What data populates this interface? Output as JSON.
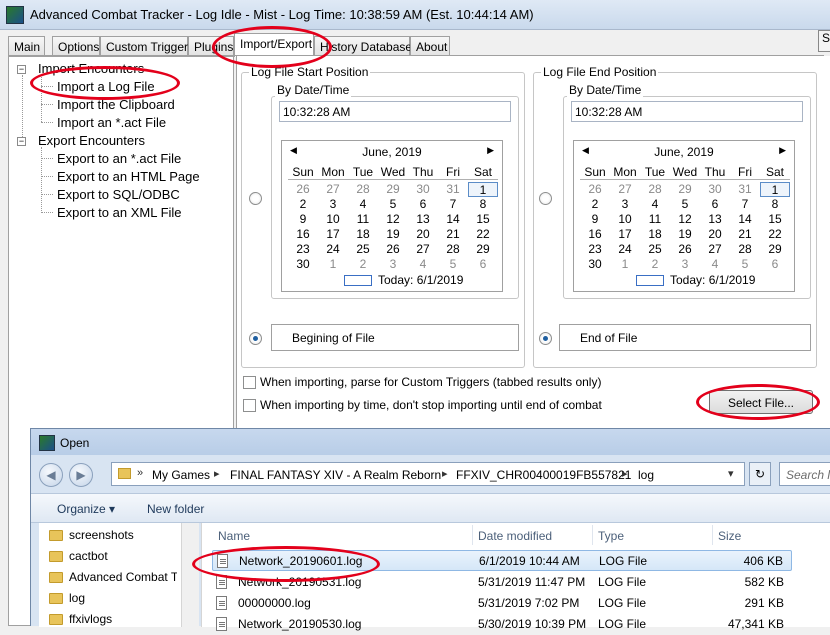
{
  "window": {
    "title": "Advanced Combat Tracker - Log Idle - Mist - Log Time: 10:38:59 AM (Est. 10:44:14 AM)"
  },
  "tabs": [
    {
      "label": "Main"
    },
    {
      "label": "Options"
    },
    {
      "label": "Custom Triggers"
    },
    {
      "label": "Plugins"
    },
    {
      "label": "Import/Export"
    },
    {
      "label": "History Database"
    },
    {
      "label": "About"
    }
  ],
  "tree": {
    "import_group": "Import Encounters",
    "import_items": [
      "Import a Log File",
      "Import the Clipboard",
      "Import an *.act File"
    ],
    "export_group": "Export Encounters",
    "export_items": [
      "Export to an *.act File",
      "Export to an HTML Page",
      "Export to SQL/ODBC",
      "Export to an XML File"
    ]
  },
  "start": {
    "legend": "Log File Start Position",
    "by_date_legend": "By Date/Time",
    "time": "10:32:28 AM",
    "edge_label": "Begining of File"
  },
  "end": {
    "legend": "Log File End Position",
    "by_date_legend": "By Date/Time",
    "time": "10:32:28 AM",
    "edge_label": "End of File"
  },
  "calendar": {
    "month_label": "June, 2019",
    "days_of_week": [
      "Sun",
      "Mon",
      "Tue",
      "Wed",
      "Thu",
      "Fri",
      "Sat"
    ],
    "weeks": [
      [
        "26",
        "27",
        "28",
        "29",
        "30",
        "31",
        "1"
      ],
      [
        "2",
        "3",
        "4",
        "5",
        "6",
        "7",
        "8"
      ],
      [
        "9",
        "10",
        "11",
        "12",
        "13",
        "14",
        "15"
      ],
      [
        "16",
        "17",
        "18",
        "19",
        "20",
        "21",
        "22"
      ],
      [
        "23",
        "24",
        "25",
        "26",
        "27",
        "28",
        "29"
      ],
      [
        "30",
        "1",
        "2",
        "3",
        "4",
        "5",
        "6"
      ]
    ],
    "today_label": "Today: 6/1/2019"
  },
  "options": {
    "parse_triggers": "When importing, parse for Custom Triggers (tabbed results only)",
    "dont_stop": "When importing by time, don't stop importing until end of combat",
    "select_file": "Select File..."
  },
  "dialog": {
    "title": "Open",
    "breadcrumb": [
      "My Games",
      "FINAL FANTASY XIV - A Realm Reborn",
      "FFXIV_CHR00400019FB557821",
      "log"
    ],
    "search_placeholder": "Search log",
    "organize": "Organize ▾",
    "new_folder": "New folder",
    "folders": [
      "screenshots",
      "cactbot",
      "Advanced Combat Tracker",
      "log",
      "ffxivlogs"
    ],
    "columns": {
      "name": "Name",
      "date": "Date modified",
      "type": "Type",
      "size": "Size"
    },
    "files": [
      {
        "name": "Network_20190601.log",
        "date": "6/1/2019 10:44 AM",
        "type": "LOG File",
        "size": "406 KB"
      },
      {
        "name": "Network_20190531.log",
        "date": "5/31/2019 11:47 PM",
        "type": "LOG File",
        "size": "582 KB"
      },
      {
        "name": "00000000.log",
        "date": "5/31/2019 7:02 PM",
        "type": "LOG File",
        "size": "291 KB"
      },
      {
        "name": "Network_20190530.log",
        "date": "5/30/2019 10:39 PM",
        "type": "LOG File",
        "size": "47,341 KB"
      }
    ]
  },
  "colors": {
    "annotation": "#e3001b",
    "selection": "#d5e7f8"
  }
}
